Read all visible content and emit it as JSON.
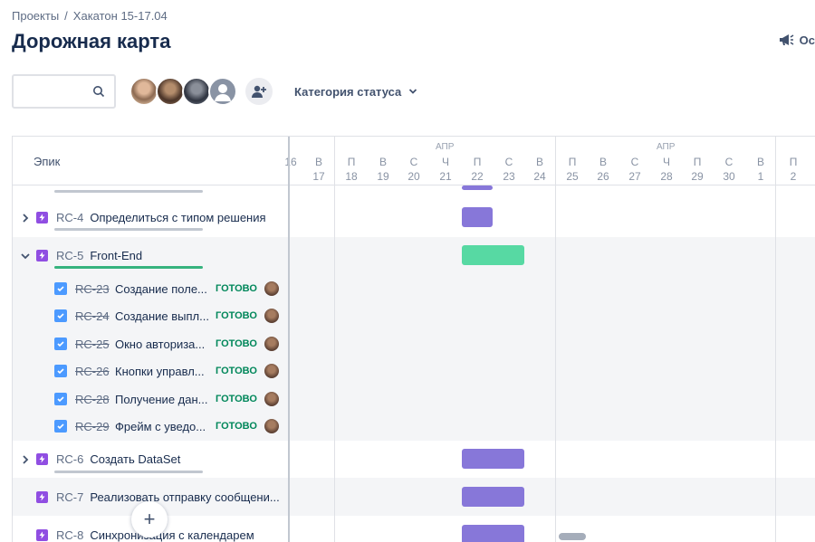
{
  "breadcrumb": {
    "projects": "Проекты",
    "separator": "/",
    "project": "Хакатон 15-17.04"
  },
  "page_title": "Дорожная карта",
  "top_right": {
    "label": "Ос"
  },
  "toolbar": {
    "search_placeholder": "",
    "status_filter": "Категория статуса"
  },
  "grid": {
    "epic_header": "Эпик",
    "months": [
      "АПР",
      "АПР"
    ],
    "days": [
      {
        "w": "",
        "d": "16"
      },
      {
        "w": "В",
        "d": "17"
      },
      {
        "w": "П",
        "d": "18"
      },
      {
        "w": "В",
        "d": "19"
      },
      {
        "w": "С",
        "d": "20"
      },
      {
        "w": "Ч",
        "d": "21"
      },
      {
        "w": "П",
        "d": "22"
      },
      {
        "w": "С",
        "d": "23"
      },
      {
        "w": "В",
        "d": "24"
      },
      {
        "w": "П",
        "d": "25"
      },
      {
        "w": "В",
        "d": "26"
      },
      {
        "w": "С",
        "d": "27"
      },
      {
        "w": "Ч",
        "d": "28"
      },
      {
        "w": "П",
        "d": "29"
      },
      {
        "w": "С",
        "d": "30"
      },
      {
        "w": "В",
        "d": "1"
      },
      {
        "w": "П",
        "d": "2"
      }
    ]
  },
  "epics": [
    {
      "key": "RC-4",
      "title": "Определиться с типом решения"
    },
    {
      "key": "RC-5",
      "title": "Front-End"
    },
    {
      "key": "RC-6",
      "title": "Создать DataSet"
    },
    {
      "key": "RC-7",
      "title": "Реализовать отправку сообщени..."
    },
    {
      "key": "RC-8",
      "title": "Синхронизация с календарем"
    }
  ],
  "subtasks": [
    {
      "key": "RC-23",
      "title": "Создание поле...",
      "status": "ГОТОВО"
    },
    {
      "key": "RC-24",
      "title": "Создание выпл...",
      "status": "ГОТОВО"
    },
    {
      "key": "RC-25",
      "title": "Окно авториза...",
      "status": "ГОТОВО"
    },
    {
      "key": "RC-26",
      "title": "Кнопки управл...",
      "status": "ГОТОВО"
    },
    {
      "key": "RC-28",
      "title": "Получение дан...",
      "status": "ГОТОВО"
    },
    {
      "key": "RC-29",
      "title": "Фрейм с уведо...",
      "status": "ГОТОВО"
    }
  ],
  "fab_label": "+",
  "colors": {
    "bar_purple": "#8777d9",
    "bar_green": "#57d9a3",
    "accent": "#0052cc"
  }
}
